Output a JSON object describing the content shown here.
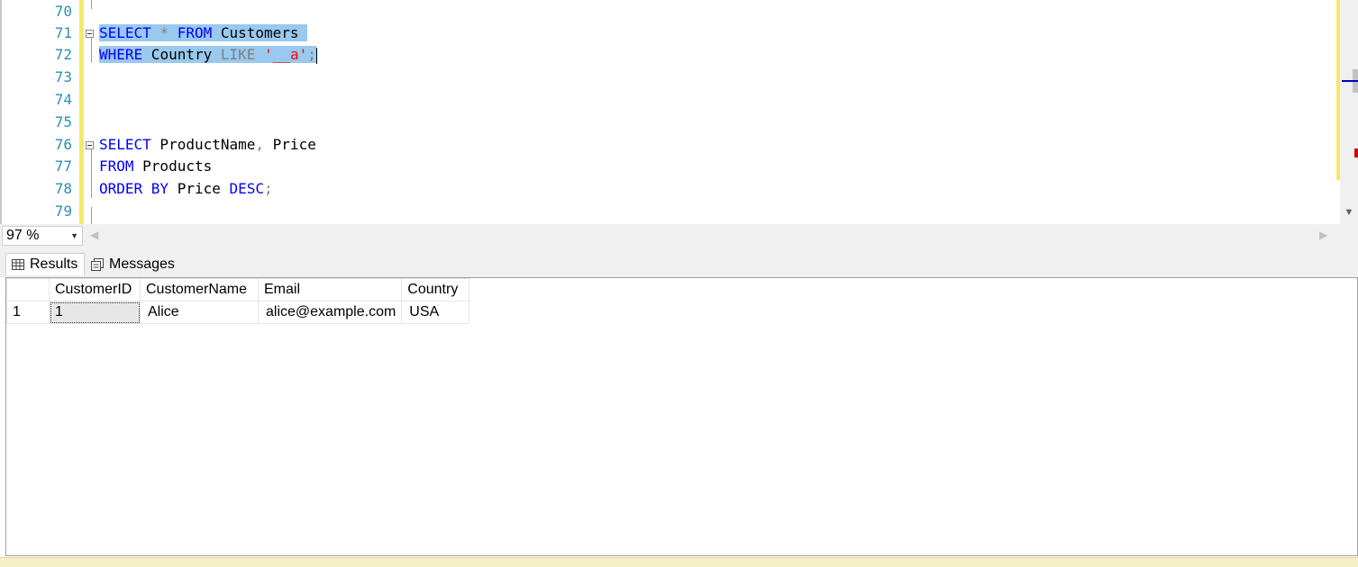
{
  "editor": {
    "line_numbers": [
      "70",
      "71",
      "72",
      "73",
      "74",
      "75",
      "76",
      "77",
      "78",
      "79"
    ],
    "lines": {
      "l71": {
        "kw1": "SELECT",
        "star": " * ",
        "kw2": "FROM",
        "rest": " Customers"
      },
      "l72": {
        "kw1": "WHERE",
        "mid": " Country ",
        "like": "LIKE",
        "sp": " ",
        "str": "'__a'",
        "semi": ";"
      },
      "l76": {
        "kw1": "SELECT",
        "rest": " ProductName",
        "comma": ",",
        "rest2": " Price"
      },
      "l77": {
        "kw1": "FROM",
        "rest": " Products"
      },
      "l78": {
        "kw1": "ORDER BY",
        "mid": " Price ",
        "kw2": "DESC",
        "semi": ";"
      }
    }
  },
  "status": {
    "zoom": "97 %"
  },
  "tabs": {
    "results": "Results",
    "messages": "Messages"
  },
  "grid": {
    "columns": [
      "CustomerID",
      "CustomerName",
      "Email",
      "Country"
    ],
    "rows": [
      {
        "num": "1",
        "CustomerID": "1",
        "CustomerName": "Alice",
        "Email": "alice@example.com",
        "Country": "USA"
      }
    ]
  },
  "colors": {
    "keyword": "#0000ff",
    "string": "#ff0000",
    "line_number": "#2b91af",
    "selection": "#99c9ef",
    "change_bar": "#f5e96b"
  }
}
